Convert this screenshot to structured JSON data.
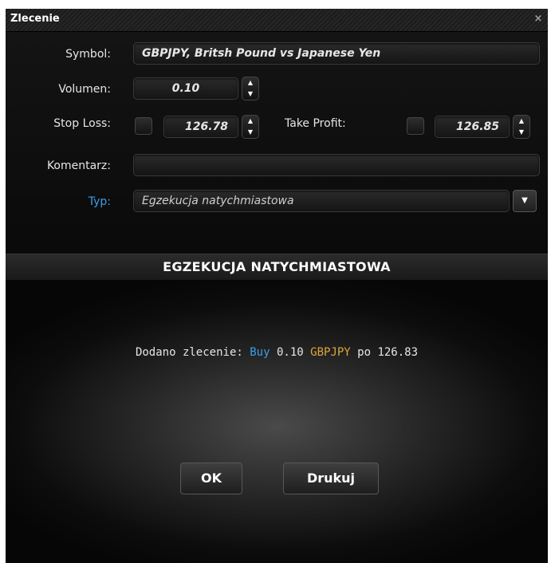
{
  "window": {
    "title": "Zlecenie",
    "close_glyph": "×"
  },
  "form": {
    "symbol": {
      "label": "Symbol:",
      "value": "GBPJPY, Britsh Pound vs Japanese Yen"
    },
    "volume": {
      "label": "Volumen:",
      "value": "0.10"
    },
    "stop_loss": {
      "label": "Stop Loss:",
      "value": "126.78",
      "checked": false
    },
    "take_profit": {
      "label": "Take Profit:",
      "value": "126.85",
      "checked": false
    },
    "comment": {
      "label": "Komentarz:",
      "value": ""
    },
    "type": {
      "label": "Typ:",
      "value": "Egzekucja natychmiastowa"
    }
  },
  "section": {
    "title": "EGZEKUCJA NATYCHMIASTOWA"
  },
  "result": {
    "prefix": "Dodano zlecenie:",
    "side": "Buy",
    "volume": "0.10",
    "symbol": "GBPJPY",
    "price_prefix": "po",
    "price": "126.83"
  },
  "buttons": {
    "ok": "OK",
    "print": "Drukuj"
  },
  "icons": {
    "spin_up": "▲",
    "spin_down": "▼",
    "dropdown": "▼"
  },
  "colors": {
    "accent_blue": "#3aa0e6",
    "symbol_orange": "#e0a53b",
    "background": "#0b0b0b"
  }
}
